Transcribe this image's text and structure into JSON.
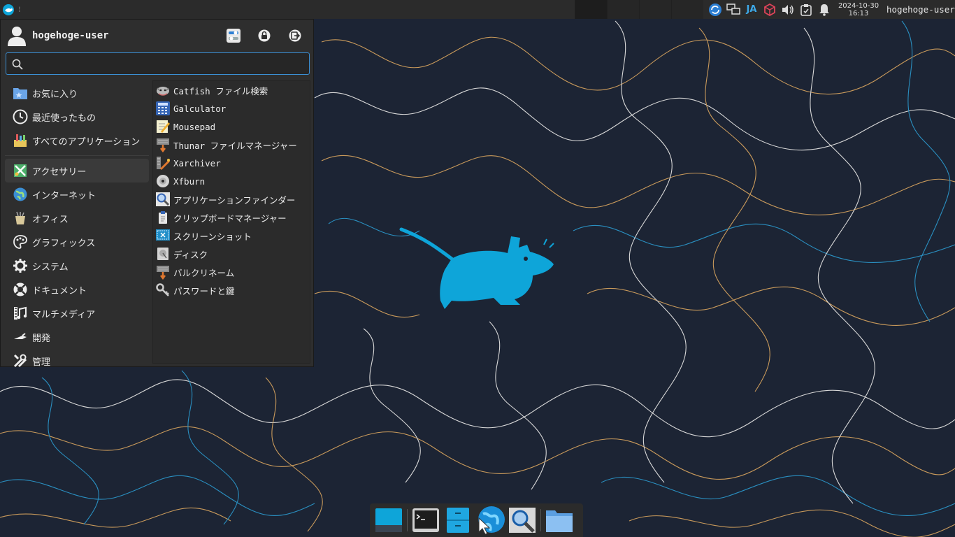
{
  "panel": {
    "lang": "JA",
    "date": "2024-10-30",
    "time": "16:13",
    "user": "hogehoge-user"
  },
  "menu": {
    "username": "hogehoge-user",
    "search": {
      "value": "",
      "placeholder": ""
    },
    "categories": [
      {
        "label": "お気に入り",
        "icon": "favorites-folder-icon"
      },
      {
        "label": "最近使ったもの",
        "icon": "clock-icon"
      },
      {
        "label": "すべてのアプリケーション",
        "icon": "all-apps-icon"
      },
      {
        "label": "アクセサリー",
        "icon": "accessories-icon",
        "active": true
      },
      {
        "label": "インターネット",
        "icon": "globe-icon"
      },
      {
        "label": "オフィス",
        "icon": "office-icon"
      },
      {
        "label": "グラフィックス",
        "icon": "palette-icon"
      },
      {
        "label": "システム",
        "icon": "gear-icon"
      },
      {
        "label": "ドキュメント",
        "icon": "help-lifebuoy-icon"
      },
      {
        "label": "マルチメディア",
        "icon": "film-music-icon"
      },
      {
        "label": "開発",
        "icon": "trowel-icon"
      },
      {
        "label": "管理",
        "icon": "tools-icon"
      }
    ],
    "apps": [
      {
        "label": "Catfish ファイル検索",
        "icon": "catfish-icon"
      },
      {
        "label": "Galculator",
        "icon": "calculator-icon"
      },
      {
        "label": "Mousepad",
        "icon": "text-editor-icon"
      },
      {
        "label": "Thunar ファイルマネージャー",
        "icon": "file-manager-icon"
      },
      {
        "label": "Xarchiver",
        "icon": "archive-icon"
      },
      {
        "label": "Xfburn",
        "icon": "disc-icon"
      },
      {
        "label": "アプリケーションファインダー",
        "icon": "magnifier-icon"
      },
      {
        "label": "クリップボードマネージャー",
        "icon": "clipboard-icon"
      },
      {
        "label": "スクリーンショット",
        "icon": "screenshot-icon"
      },
      {
        "label": "ディスク",
        "icon": "disk-icon"
      },
      {
        "label": "バルクリネーム",
        "icon": "bulk-rename-icon"
      },
      {
        "label": "パスワードと鍵",
        "icon": "keys-icon"
      }
    ]
  },
  "colors": {
    "accent": "#0ea5d9",
    "panel": "#2b2b2b",
    "wallpaper": "#1c2434"
  }
}
